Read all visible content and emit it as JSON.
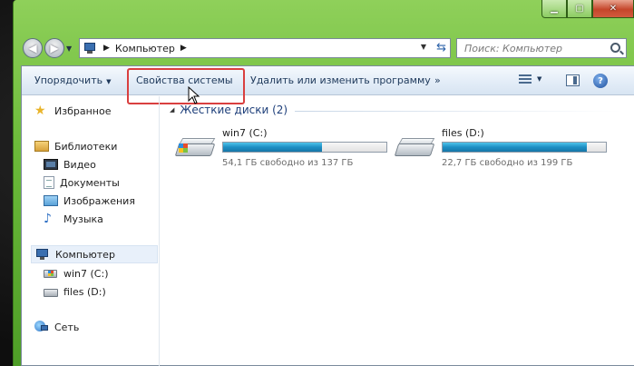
{
  "address": {
    "path": "Компьютер",
    "search_placeholder": "Поиск: Компьютер"
  },
  "toolbar": {
    "organize_label": "Упорядочить",
    "system_properties_label": "Свойства системы",
    "uninstall_label": "Удалить или изменить программу",
    "more_label": "»",
    "help_label": "?"
  },
  "nav": {
    "favorites": "Избранное",
    "libraries": "Библиотеки",
    "video": "Видео",
    "documents": "Документы",
    "images": "Изображения",
    "music": "Музыка",
    "computer": "Компьютер",
    "drive_c": "win7 (C:)",
    "drive_d": "files (D:)",
    "network": "Сеть"
  },
  "content": {
    "group_title": "Жесткие диски (2)",
    "drives": [
      {
        "name": "win7 (C:)",
        "free_text": "54,1 ГБ свободно из 137 ГБ",
        "used_fraction": 0.605
      },
      {
        "name": "files (D:)",
        "free_text": "22,7 ГБ свободно из 199 ГБ",
        "used_fraction": 0.886
      }
    ]
  },
  "colors": {
    "highlight_box": "#d93f3f",
    "frame_green": "#6cbb3a",
    "bar_fill": "#1e8fc4"
  }
}
